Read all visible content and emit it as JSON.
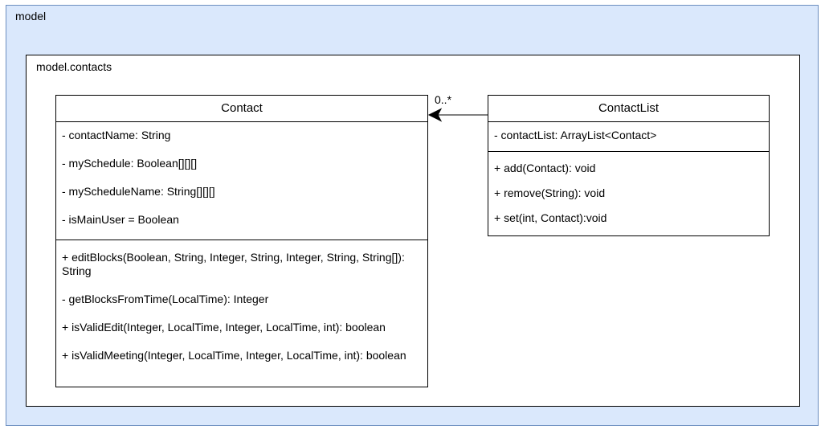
{
  "packages": {
    "outer": {
      "label": "model"
    },
    "inner": {
      "label": "model.contacts"
    }
  },
  "classes": {
    "contact": {
      "name": "Contact",
      "attributes": [
        "- contactName: String",
        "- mySchedule: Boolean[][][]",
        "- myScheduleName: String[][][]",
        "- isMainUser = Boolean"
      ],
      "operations": [
        "+ editBlocks(Boolean, String, Integer, String, Integer, String, String[]): String",
        "- getBlocksFromTime(LocalTime): Integer",
        "+ isValidEdit(Integer, LocalTime, Integer, LocalTime, int): boolean",
        "+ isValidMeeting(Integer, LocalTime, Integer, LocalTime, int): boolean"
      ]
    },
    "contactlist": {
      "name": "ContactList",
      "attributes": [
        "- contactList: ArrayList<Contact>"
      ],
      "operations": [
        "+ add(Contact): void",
        "+ remove(String): void",
        "+ set(int, Contact):void"
      ]
    }
  },
  "association": {
    "multiplicity": "0..*"
  },
  "colors": {
    "package_fill": "#dae8fc",
    "package_border": "#6c8ebf"
  }
}
